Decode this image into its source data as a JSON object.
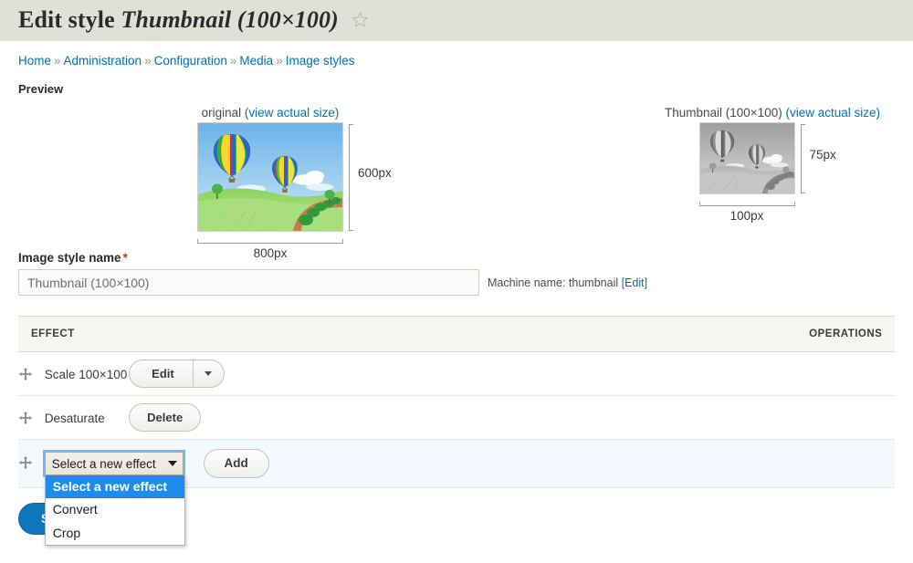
{
  "header": {
    "title_prefix": "Edit style",
    "style_name": "Thumbnail (100×100)",
    "favorite_icon": "star-outline-icon"
  },
  "breadcrumb": {
    "separator": "»",
    "items": [
      {
        "label": "Home"
      },
      {
        "label": "Administration"
      },
      {
        "label": "Configuration"
      },
      {
        "label": "Media"
      },
      {
        "label": "Image styles"
      }
    ]
  },
  "preview": {
    "section_label": "Preview",
    "original": {
      "caption": "original",
      "link_label": "(view actual size)",
      "width_label": "800px",
      "height_label": "600px"
    },
    "derivative": {
      "caption": "Thumbnail (100×100)",
      "link_label": "(view actual size)",
      "width_label": "100px",
      "height_label": "75px"
    }
  },
  "name_field": {
    "label": "Image style name",
    "required_marker": "*",
    "value": "Thumbnail (100×100)",
    "placeholder": "Thumbnail (100×100)",
    "machine_name_prefix": "Machine name: thumbnail",
    "machine_name_edit": "[Edit]"
  },
  "effects": {
    "columns": {
      "effect": "EFFECT",
      "operations": "OPERATIONS"
    },
    "rows": [
      {
        "drag_icon": "drag-move-icon",
        "label": "Scale 100×100",
        "op_type": "dropbutton",
        "op_label": "Edit",
        "op_toggle_icon": "chevron-down-icon"
      },
      {
        "drag_icon": "drag-move-icon",
        "label": "Desaturate",
        "op_type": "button",
        "op_label": "Delete"
      }
    ],
    "new_effect_row": {
      "drag_icon": "drag-move-icon",
      "select": {
        "value": "Select a new effect",
        "caret_icon": "chevron-down-icon",
        "expanded": true,
        "options": [
          {
            "label": "Select a new effect",
            "selected": true
          },
          {
            "label": "Convert",
            "selected": false
          },
          {
            "label": "Crop",
            "selected": false
          }
        ]
      },
      "add_label": "Add"
    }
  },
  "actions": {
    "save_label": "Save"
  },
  "colors": {
    "link": "#0071b3",
    "titlebar_bg": "#e0e0d8",
    "required": "#e7280e",
    "primary_button": "#0e76bc",
    "option_highlight": "#1f8ced",
    "new_row_bg": "#f3f9fe"
  }
}
